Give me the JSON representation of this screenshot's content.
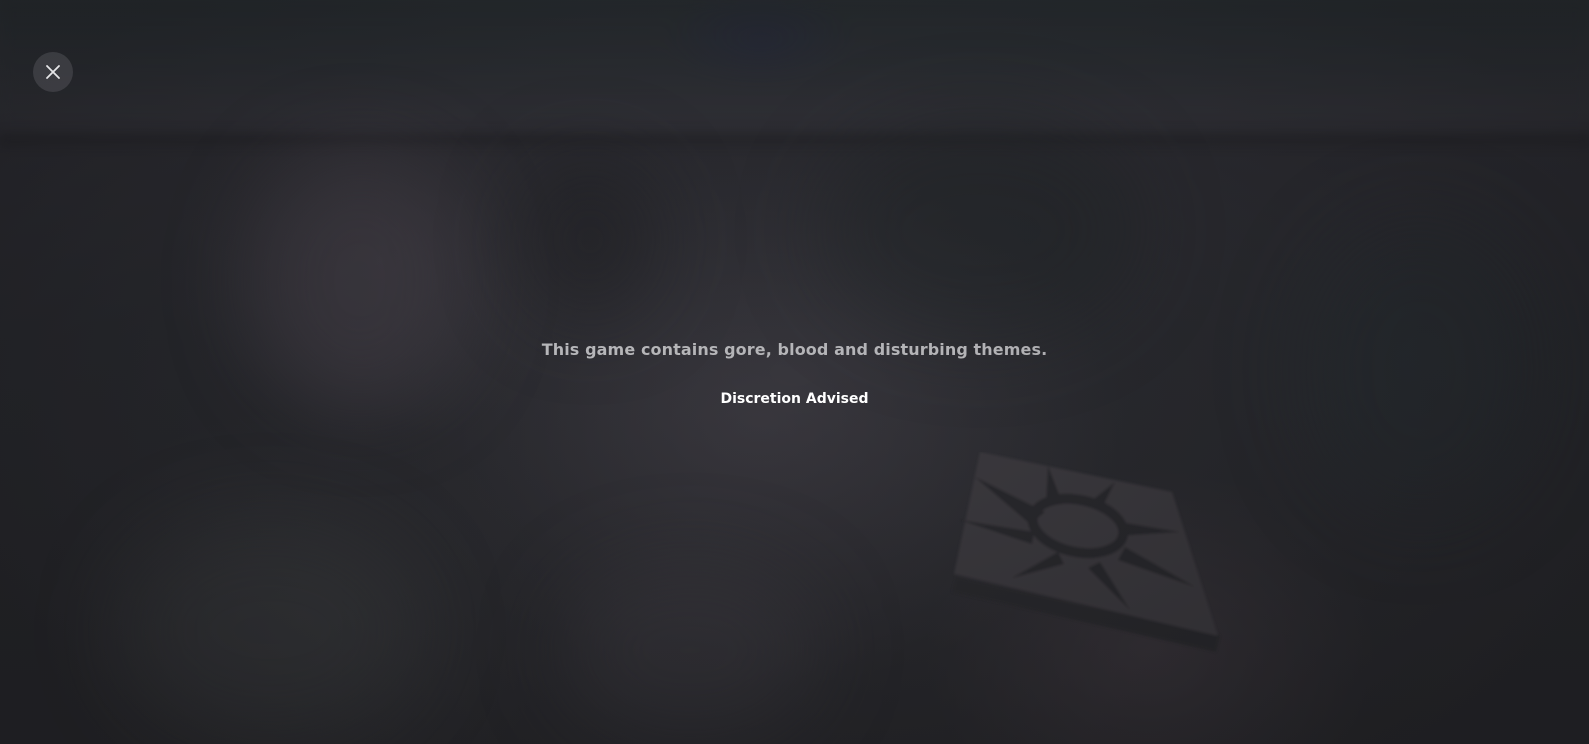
{
  "overlay": {
    "close_icon": "close-icon",
    "warning_message": "This game contains gore, blood and disturbing themes.",
    "advisory_label": "Discretion Advised"
  },
  "colors": {
    "background": "#29292d",
    "message_text": "#b4b4b7",
    "advisory_text": "#ffffff",
    "close_button_bg": "#505056"
  }
}
